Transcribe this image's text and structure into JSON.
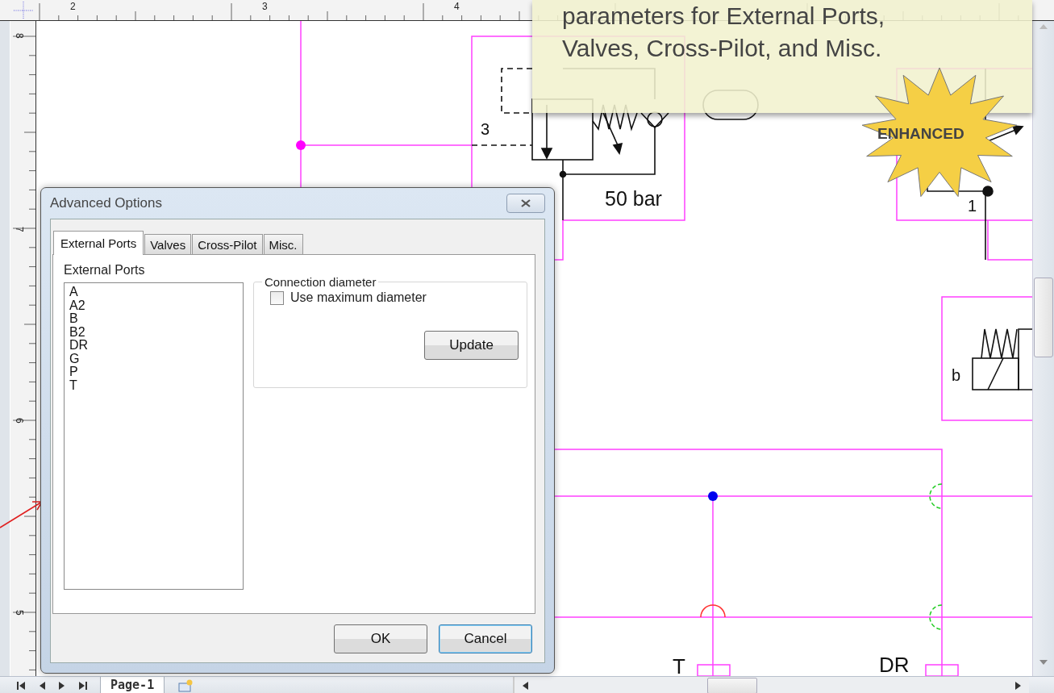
{
  "ruler": {
    "top_labels": [
      "2",
      "3",
      "4"
    ],
    "left_labels": [
      "8",
      "7",
      "6",
      "5"
    ]
  },
  "diagram": {
    "labels": [
      {
        "text": "3"
      },
      {
        "text": "50 bar"
      },
      {
        "text": "1"
      },
      {
        "text": "b"
      },
      {
        "text": "T"
      },
      {
        "text": "DR"
      }
    ]
  },
  "callout": {
    "text": "parameters for External Ports, Valves, Cross-Pilot, and Misc."
  },
  "badge": {
    "text": "ENHANCED"
  },
  "dialog": {
    "title": "Advanced Options",
    "tabs": [
      {
        "label": "External Ports",
        "selected": true
      },
      {
        "label": "Valves",
        "selected": false
      },
      {
        "label": "Cross-Pilot",
        "selected": false
      },
      {
        "label": "Misc.",
        "selected": false
      }
    ],
    "list_label": "External Ports",
    "ports": [
      "A",
      "A2",
      "B",
      "B2",
      "DR",
      "G",
      "P",
      "T"
    ],
    "group_label": "Connection diameter",
    "checkbox": {
      "label": "Use maximum diameter",
      "checked": false
    },
    "update_button": "Update",
    "ok_button": "OK",
    "cancel_button": "Cancel"
  },
  "page_tabs": [
    {
      "label": "Page-1",
      "selected": true
    }
  ]
}
